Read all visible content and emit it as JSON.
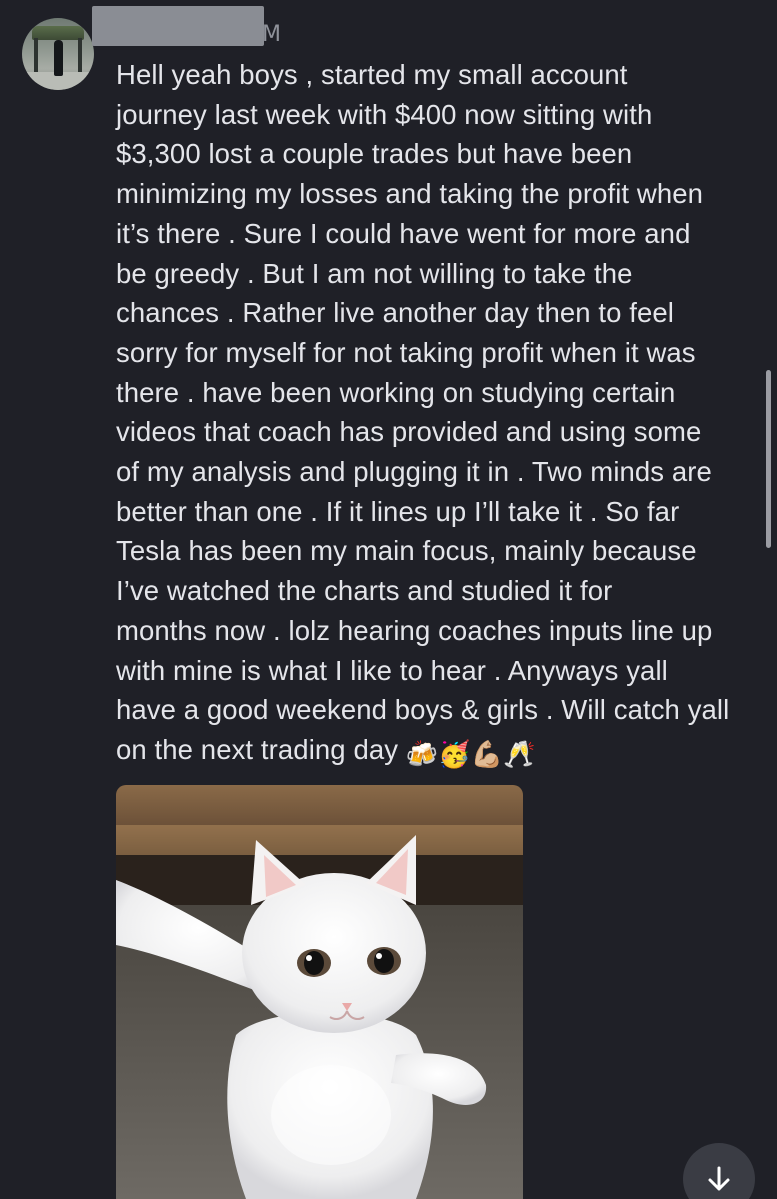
{
  "message": {
    "author_name_redacted": true,
    "timestamp_partial": "M",
    "text": "Hell yeah boys , started my small account\njourney last week with $400 now sitting with\n$3,300 lost a couple trades but have been\nminimizing my losses and taking the profit when\nit’s there . Sure I could have went for more and\nbe greedy . But I am not willing to take the\nchances . Rather live another day then to feel\nsorry for myself for not taking profit when it was\nthere . have been working on studying certain\nvideos that coach has provided and using some\nof my analysis and plugging it in . Two minds are\nbetter than one . If it lines up I’ll take it . So far\nTesla has been my main focus, mainly because\nI’ve watched the charts and studied it for\nmonths now . lolz hearing coaches inputs line up\nwith mine is what I like to hear . Anyways yall\nhave a good weekend boys & girls . Will catch yall\non the next trading day ",
    "emojis": [
      "🍻",
      "🥳",
      "💪🏼",
      "🥂"
    ]
  },
  "attachment": {
    "type": "gif",
    "subject_icon": "white-cat-dancing"
  },
  "controls": {
    "jump_icon": "arrow-down-icon"
  },
  "colors": {
    "background": "#1f2027",
    "text": "#e4e5ea",
    "redaction": "#8a8d94",
    "button": "#3a3c44"
  }
}
